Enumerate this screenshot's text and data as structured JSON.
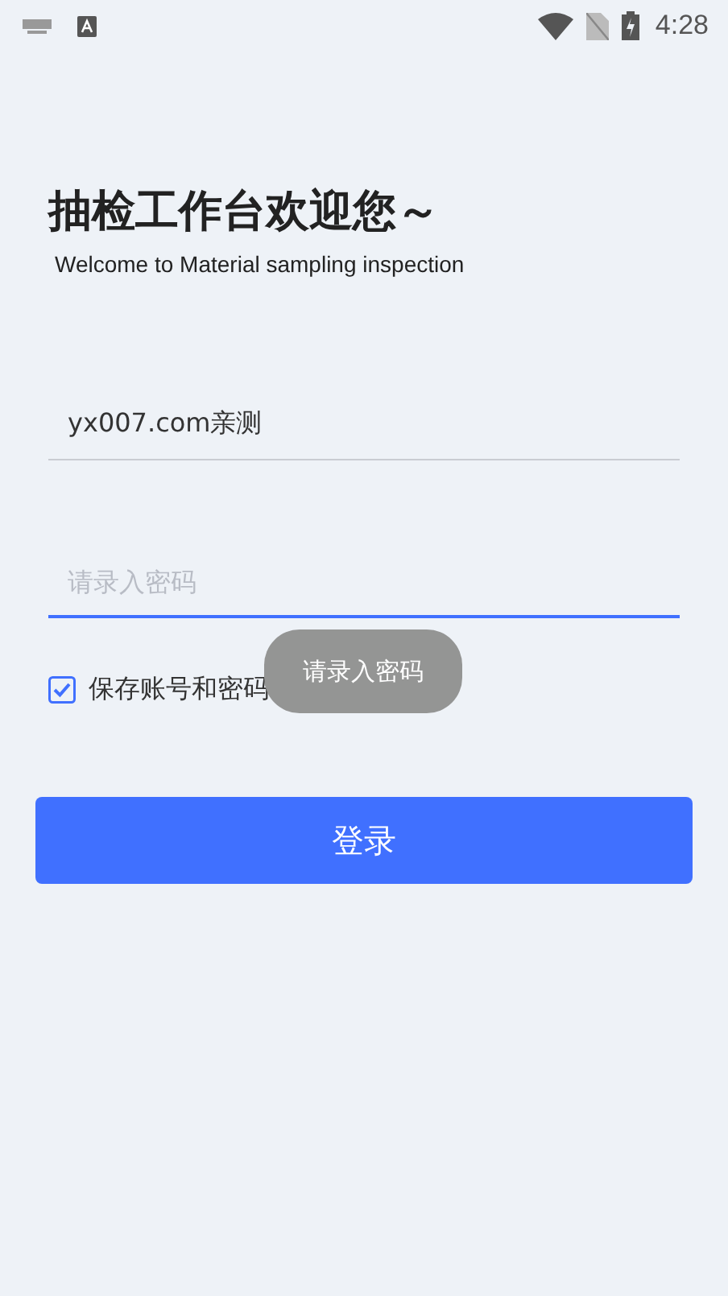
{
  "status_bar": {
    "time": "4:28"
  },
  "title": "抽检工作台欢迎您～",
  "subtitle": "Welcome to Material sampling inspection",
  "username": {
    "value": "yx007.com亲测",
    "focused": false
  },
  "password": {
    "placeholder": "请录入密码",
    "focused": true
  },
  "remember": {
    "label": "保存账号和密码",
    "checked": true
  },
  "login_button": "登录",
  "toast": "请录入密码"
}
